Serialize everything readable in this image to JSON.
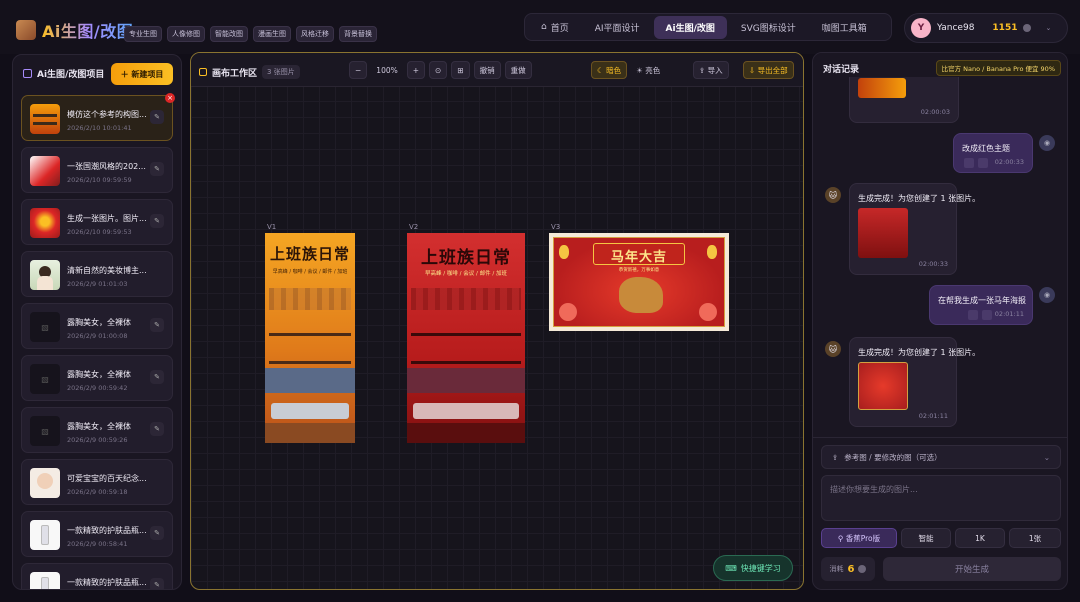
{
  "brand": {
    "title": "Ai生图/改图",
    "chips": [
      "专业生图",
      "人像修图",
      "智能改图",
      "漫画生图",
      "风格迁移",
      "背景替换"
    ]
  },
  "nav": {
    "items": [
      {
        "label": "首页",
        "icon": "home-icon"
      },
      {
        "label": "AI平面设计",
        "icon": ""
      },
      {
        "label": "Ai生图/改图",
        "icon": "",
        "active": true
      },
      {
        "label": "SVG图标设计",
        "icon": ""
      },
      {
        "label": "咖图工具箱",
        "icon": ""
      }
    ]
  },
  "user": {
    "initial": "Y",
    "name": "Yance98",
    "credits": "1151"
  },
  "left": {
    "title": "Ai生图/改图项目",
    "new_label": "新建项目",
    "projects": [
      {
        "title": "模仿这个参考的构图...",
        "date": "2026/2/10 10:01:41",
        "thumb": "office"
      },
      {
        "title": "一张国潮风格的202...",
        "date": "2026/2/10 09:59:59",
        "thumb": "red"
      },
      {
        "title": "生成一张图片。图片...",
        "date": "2026/2/10 09:59:53",
        "thumb": "redgold"
      },
      {
        "title": "清新自然的美妆博主...",
        "date": "2026/2/9 01:01:03",
        "thumb": "portrait"
      },
      {
        "title": "露胸美女，全裸体",
        "date": "2026/2/9 01:00:08",
        "thumb": "empty"
      },
      {
        "title": "露胸美女，全裸体",
        "date": "2026/2/9 00:59:42",
        "thumb": "empty"
      },
      {
        "title": "露胸美女，全裸体",
        "date": "2026/2/9 00:59:26",
        "thumb": "empty"
      },
      {
        "title": "可爱宝宝的百天纪念...",
        "date": "2026/2/9 00:59:18",
        "thumb": "baby"
      },
      {
        "title": "一款精致的护肤品瓶...",
        "date": "2026/2/9 00:58:41",
        "thumb": "bottle"
      },
      {
        "title": "一款精致的护肤品瓶...",
        "date": "",
        "thumb": "bottle"
      }
    ]
  },
  "canvas": {
    "title": "画布工作区",
    "count": "3 张图片",
    "zoom": "100%",
    "undo": "撤销",
    "redo": "重做",
    "dark": "暗色",
    "light": "亮色",
    "import": "导入",
    "export": "导出全部",
    "shortcut": "快捷键学习",
    "versions": [
      {
        "label": "V1",
        "title": "上班族日常",
        "subtitle": "早高峰 / 咖啡 / 会议 / 邮件 / 加班",
        "theme": "orange"
      },
      {
        "label": "V2",
        "title": "上班族日常",
        "subtitle": "早高峰 / 咖啡 / 会议 / 邮件 / 加班",
        "theme": "red"
      },
      {
        "label": "V3",
        "title": "马年大吉",
        "subtitle": "恭贺新禧，万事如意",
        "theme": "horse"
      }
    ]
  },
  "chat": {
    "title": "对话记录",
    "model": "比官方 Nano / Banana Pro 便宜 90%",
    "messages": [
      {
        "role": "bot-image",
        "time": "02:00:03"
      },
      {
        "role": "user",
        "text": "改成红色主题",
        "time": "02:00:33"
      },
      {
        "role": "bot",
        "text": "生成完成！为您创建了 1 张图片。",
        "time": "02:00:33"
      },
      {
        "role": "user",
        "text": "在帮我生成一张马年海报",
        "time": "02:01:11"
      },
      {
        "role": "bot",
        "text": "生成完成！为您创建了 1 张图片。",
        "time": "02:01:11"
      }
    ],
    "ref_label": "参考图 / 要修改的图（可选）",
    "placeholder": "描述你想要生成的图片...",
    "options": [
      "香蕉Pro版",
      "智能",
      "1K",
      "1张"
    ],
    "cost_label": "消耗",
    "cost_value": "6",
    "generate": "开始生成"
  },
  "colors": {
    "accent": "#fbbf24",
    "purple": "#3e3058",
    "canvas_border": "#8a7430"
  }
}
